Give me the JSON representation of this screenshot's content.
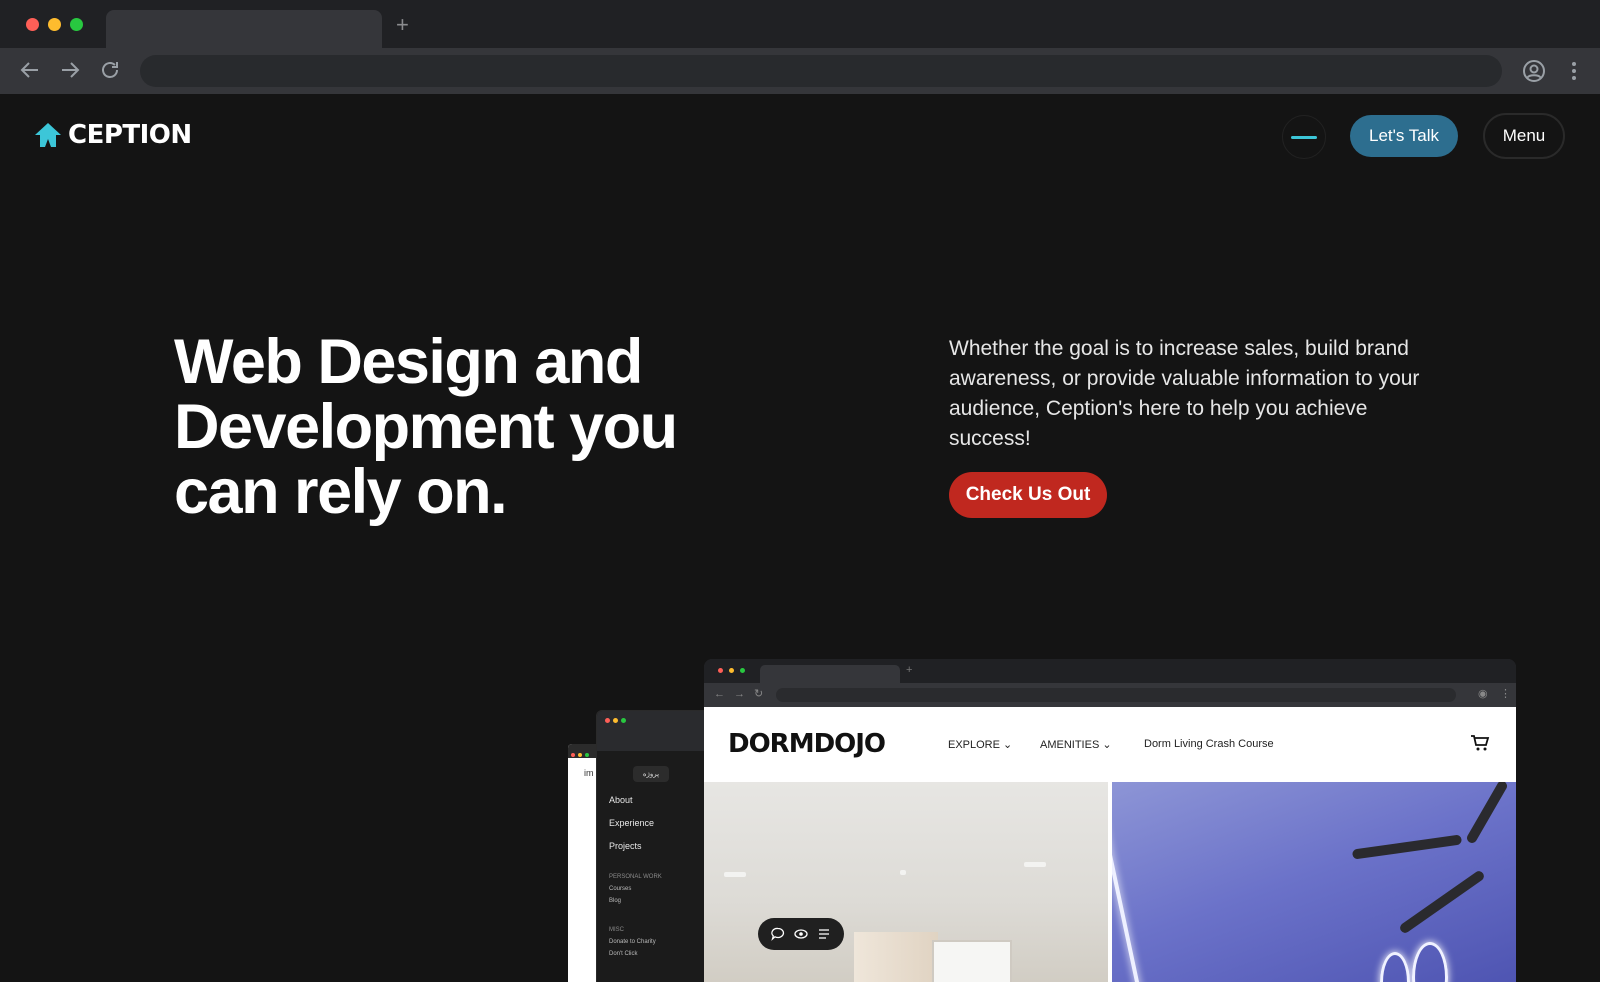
{
  "browser": {
    "new_tab_label": "+"
  },
  "header": {
    "logo_text": "CEPTION",
    "talk_label": "Let's Talk",
    "menu_label": "Menu",
    "accent": "#3cc6d8",
    "talk_color": "#2d6e8f"
  },
  "hero": {
    "title_lines": [
      "Web Design and",
      "Development you",
      "can rely on."
    ],
    "description": "Whether the goal is to increase sales, build brand awareness, or provide valuable information to your audience, Ception's here to help you achieve success!",
    "cta_label": "Check Us Out",
    "cta_color": "#c0281f"
  },
  "mockup_back": {
    "text": "im"
  },
  "mockup_mid": {
    "badge": "پروژه",
    "items": [
      "About",
      "Experience",
      "Projects"
    ],
    "section1_title": "PERSONAL WORK",
    "section1_items": [
      "Courses",
      "Blog"
    ],
    "section2_title": "MISC",
    "section2_items": [
      "Donate to Charity",
      "Don't Click"
    ]
  },
  "mockup_front": {
    "brand": "DORMDOJO",
    "nav": [
      "EXPLORE ⌄",
      "AMENITIES ⌄",
      "Dorm Living Crash Course"
    ],
    "new_tab_label": "+"
  }
}
